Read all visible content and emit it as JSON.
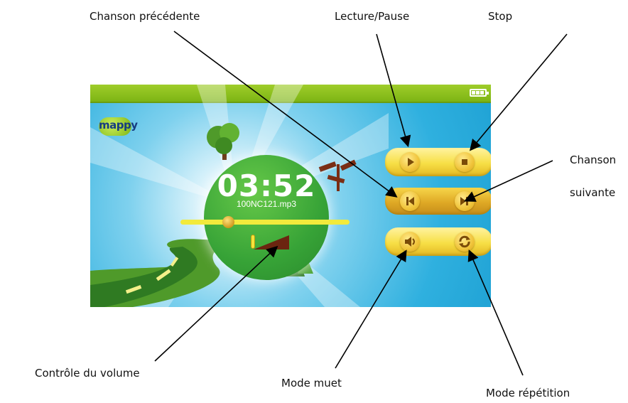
{
  "callouts": {
    "prev": "Chanson précédente",
    "play": "Lecture/Pause",
    "stop": "Stop",
    "next_line1": "Chanson",
    "next_line2": "suivante",
    "volume": "Contrôle du volume",
    "mute": "Mode muet",
    "repeat": "Mode répétition"
  },
  "player": {
    "logo": "mappy",
    "time": "03:52",
    "filename": "100NC121.mp3",
    "progress_fraction": 0.28
  },
  "colors": {
    "topbar": "#8cc11e",
    "screen_blue": "#2fb0df",
    "disc_green": "#37a337",
    "button_yellow": "#f7df46"
  },
  "icons": {
    "play": "play-icon",
    "stop": "stop-icon",
    "prev": "skip-back-icon",
    "next": "skip-forward-icon",
    "mute": "speaker-icon",
    "repeat": "repeat-icon",
    "battery": "battery-icon"
  }
}
